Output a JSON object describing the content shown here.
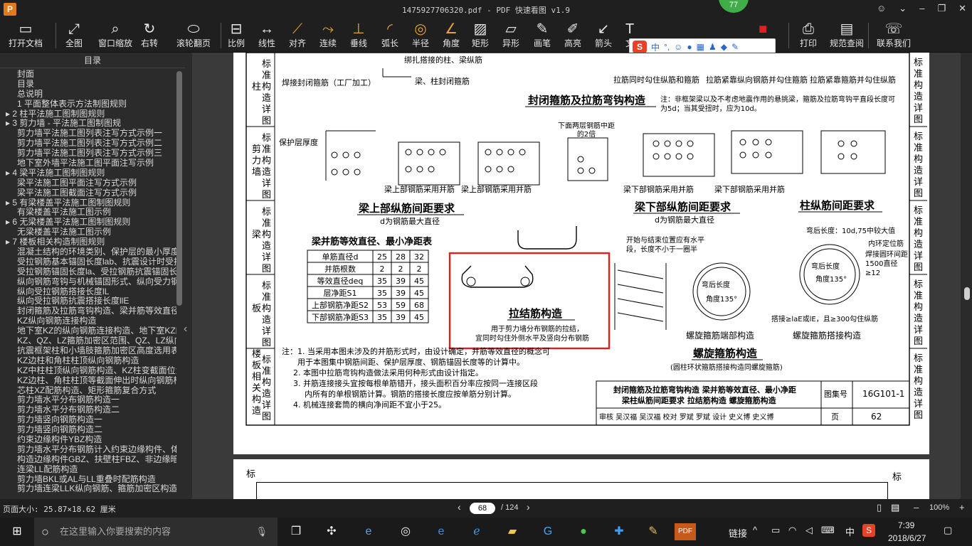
{
  "window": {
    "title": "1475927706320.pdf - PDF 快速看图 v1.9",
    "app_icon": "P",
    "badge": "77"
  },
  "toolbar": {
    "items": [
      {
        "label": "打开文档",
        "icon": "folder-icon"
      },
      {
        "label": "全图",
        "icon": "fullscreen-icon"
      },
      {
        "label": "窗口缩放",
        "icon": "zoom-icon"
      },
      {
        "label": "右转",
        "icon": "rotate-icon"
      },
      {
        "label": "滚轮翻页",
        "icon": "mouse-icon"
      },
      {
        "label": "比例",
        "icon": "scale-icon"
      },
      {
        "label": "线性",
        "icon": "linear-icon"
      },
      {
        "label": "对齐",
        "icon": "align-icon"
      },
      {
        "label": "连续",
        "icon": "continuous-icon"
      },
      {
        "label": "垂线",
        "icon": "perpendicular-icon"
      },
      {
        "label": "弧长",
        "icon": "arc-icon"
      },
      {
        "label": "半径",
        "icon": "radius-icon"
      },
      {
        "label": "角度",
        "icon": "angle-icon"
      },
      {
        "label": "矩形",
        "icon": "rect-icon"
      },
      {
        "label": "异形",
        "icon": "polygon-icon"
      },
      {
        "label": "画笔",
        "icon": "pen-icon"
      },
      {
        "label": "高亮",
        "icon": "highlight-icon"
      },
      {
        "label": "箭头",
        "icon": "arrow-icon"
      },
      {
        "label": "文",
        "icon": "text-icon"
      },
      {
        "label": "色",
        "icon": "color-icon"
      },
      {
        "label": "打印",
        "icon": "print-icon"
      },
      {
        "label": "规范查阅",
        "icon": "book-icon"
      },
      {
        "label": "联系我们",
        "icon": "contact-icon"
      }
    ]
  },
  "ime": {
    "logo": "S",
    "lang": "中",
    "punct": "°,"
  },
  "sidebar": {
    "header": "目录",
    "items": [
      {
        "t": "封面",
        "lvl": "l1"
      },
      {
        "t": "目录",
        "lvl": "l1"
      },
      {
        "t": "总说明",
        "lvl": "l1"
      },
      {
        "t": "1 平面整体表示方法制图规则",
        "lvl": "l1"
      },
      {
        "t": "▸ 2 柱平法施工图制图规则",
        "lvl": "l1e"
      },
      {
        "t": "▸ 3 剪力墙 - 平法施工图制图规",
        "lvl": "l1e"
      },
      {
        "t": "剪力墙平法施工图列表注写方式示例一",
        "lvl": "l2"
      },
      {
        "t": "剪力墙平法施工图列表注写方式示例二",
        "lvl": "l2"
      },
      {
        "t": "剪力墙平法施工图列表注写方式示例三",
        "lvl": "l2"
      },
      {
        "t": "地下室外墙平法施工图平面注写示例",
        "lvl": "l2"
      },
      {
        "t": "▸ 4 梁平法施工图制图规则",
        "lvl": "l1e"
      },
      {
        "t": "梁平法施工图平面注写方式示例",
        "lvl": "l2"
      },
      {
        "t": "梁平法施工图截面注写方式示例",
        "lvl": "l2"
      },
      {
        "t": "▸ 5 有梁楼盖平法施工图制图规则",
        "lvl": "l1e"
      },
      {
        "t": "有梁楼盖平法施工图示例",
        "lvl": "l2"
      },
      {
        "t": "▸ 6 无梁楼盖平法施工图制图规则",
        "lvl": "l1e"
      },
      {
        "t": "无梁楼盖平法施工图示例",
        "lvl": "l2"
      },
      {
        "t": "▸ 7 楼板相关构造制图规则",
        "lvl": "l1e"
      },
      {
        "t": "混凝土结构的环境类别、保护层的最小厚度",
        "lvl": "l2"
      },
      {
        "t": "受拉钢筋基本锚固长度lab、抗震设计时受拉",
        "lvl": "l2"
      },
      {
        "t": "受拉钢筋锚固长度la、受拉钢筋抗震锚固长",
        "lvl": "l2"
      },
      {
        "t": "纵向钢筋弯钩与机械锚固形式、纵向受力钢",
        "lvl": "l2"
      },
      {
        "t": "纵向受拉钢筋搭接长度lL",
        "lvl": "l2"
      },
      {
        "t": "纵向受拉钢筋抗震搭接长度llE",
        "lvl": "l2"
      },
      {
        "t": "封闭箍筋及拉筋弯钩构造、梁并筋等效直径",
        "lvl": "l2"
      },
      {
        "t": "KZ纵向钢筋连接构造",
        "lvl": "l2"
      },
      {
        "t": "地下室KZ的纵向钢筋连接构造、地下室KZ的",
        "lvl": "l2"
      },
      {
        "t": "KZ、QZ、LZ箍筋加密区范围、QZ、LZ纵向钢",
        "lvl": "l2"
      },
      {
        "t": "抗震框架柱和小墙肢箍筋加密区高度选用表",
        "lvl": "l2"
      },
      {
        "t": "KZ边柱和角柱柱顶纵向钢筋构造",
        "lvl": "l2"
      },
      {
        "t": "KZ中柱柱顶纵向钢筋构造、KZ柱变截面位置",
        "lvl": "l2"
      },
      {
        "t": "KZ边柱、角柱柱顶等截面伸出时纵向钢筋构",
        "lvl": "l2"
      },
      {
        "t": "芯柱XZ配筋构造、矩形箍筋复合方式",
        "lvl": "l2"
      },
      {
        "t": "剪力墙水平分布钢筋构造一",
        "lvl": "l2"
      },
      {
        "t": "剪力墙水平分布钢筋构造二",
        "lvl": "l2"
      },
      {
        "t": "剪力墙竖向钢筋构造一",
        "lvl": "l2"
      },
      {
        "t": "剪力墙竖向钢筋构造二",
        "lvl": "l2"
      },
      {
        "t": "约束边缘构件YBZ构造",
        "lvl": "l2"
      },
      {
        "t": "剪力墙水平分布钢筋计入约束边缘构件、体",
        "lvl": "l2"
      },
      {
        "t": "构造边缘构件GBZ、扶壁柱FBZ、非边缘暗柱",
        "lvl": "l2"
      },
      {
        "t": "连梁LL配筋构造",
        "lvl": "l2"
      },
      {
        "t": "剪力墙BKL或AL与LL重叠时配筋构造",
        "lvl": "l2"
      },
      {
        "t": "剪力墙连梁LLK纵向钢筋、箍筋加密区构造",
        "lvl": "l2"
      }
    ]
  },
  "page": {
    "left_tabs": [
      {
        "cat": "柱",
        "label": "标准构造详图"
      },
      {
        "cat": "剪力墙",
        "label": "标准构造详图"
      },
      {
        "cat": "梁",
        "label": "标准构造详图"
      },
      {
        "cat": "板",
        "label": "标准构造详图"
      },
      {
        "cat": "楼板相关构造",
        "label": "标准构造详图"
      }
    ],
    "right_tabs": [
      "标准构造详图",
      "标准构造详图",
      "标准构造详图",
      "标准构造详图",
      "标准构造详图"
    ],
    "top_labels": [
      "焊接封闭箍筋（工厂加工）",
      "绑扎搭接的柱、梁纵筋",
      "梁、柱封闭箍筋",
      "拉筋同时勾住纵筋和箍筋",
      "拉筋紧靠纵向钢筋并勾住箍筋",
      "拉筋紧靠箍筋并勾住纵筋"
    ],
    "t1": "封闭箍筋及拉筋弯钩构造",
    "note1": "注：非框架梁以及不考虑地震作用的悬挑梁，箍筋及拉筋弯钩平直段长度可为5d；当其受扭时，应为10d。",
    "t2": "梁上部纵筋间距要求",
    "t2s": "d为钢筋最大直径",
    "t3": "梁下部纵筋间距要求",
    "t3s": "d为钢筋最大直径",
    "t4": "柱纵筋间距要求",
    "sublabels": [
      "梁上部钢筋采用并筋",
      "梁上部钢筋采用并筋",
      "梁下部钢筋采用并筋",
      "梁下部钢筋采用并筋"
    ],
    "cover_label": "保护层厚度",
    "lower2": "下面两层钢筋中距的2倍",
    "table": {
      "title": "梁并筋等效直径、最小净距表",
      "rows": [
        [
          "单筋直径d",
          "25",
          "28",
          "32"
        ],
        [
          "并筋根数",
          "2",
          "2",
          "2"
        ],
        [
          "等效直径deq",
          "35",
          "39",
          "45"
        ],
        [
          "层净距S1",
          "35",
          "39",
          "45"
        ],
        [
          "上部钢筋净距S2",
          "53",
          "59",
          "68"
        ],
        [
          "下部钢筋净距S3",
          "35",
          "39",
          "45"
        ]
      ]
    },
    "tie": {
      "title": "拉结筋构造",
      "desc1": "用于剪力墙分布钢筋的拉结，",
      "desc2": "宜同时勾住外侧水平及竖向分布钢筋"
    },
    "spiral": {
      "title": "螺旋箍筋构造",
      "sub": "(圆柱环状箍筋搭接构造同螺旋箍筋)",
      "end_label": "螺旋箍筋端部构造",
      "lap_label": "螺旋箍筋搭接构造",
      "start_note": "开始与结束位置应有水平段，长度不小于一圈半",
      "bend": "弯后长度：10d,75中较大值",
      "bend2": "弯后长度",
      "angle": "角度135°",
      "inner": "内环定位筋",
      "weld": "焊接圆环间距1500直径≥12",
      "lap": "搭接≥laE或lE，且≥300勾住纵筋"
    },
    "notes": [
      "注：1. 当采用本图未涉及的并筋形式时，由设计确定，并筋等效直径的概念可",
      "用于本图集中钢筋间距、保护层厚度、钢筋锚固长度等的计算中。",
      "2. 本图中拉筋弯钩构造做法采用何种形式由设计指定。",
      "3. 并筋连接接头宜按每根单筋错开，接头面积百分率应按同一连接区段",
      "内所有的单根钢筋计算。钢筋的搭接长度应按单筋分别计算。",
      "4. 机械连接套筒的横向净间距不宜小于25。"
    ],
    "title_block": {
      "l1": "封闭箍筋及拉筋弯钩构造  梁并筋等效直径、最小净距",
      "l2": "梁柱纵筋间距要求  拉结筋构造  螺旋箍筋构造",
      "atlas_label": "图集号",
      "atlas": "16G101-1",
      "page_label": "页",
      "page": "62",
      "sign": "审核 吴汉福 吴汉福 校对 罗斌 罗斌 设计 史义博 史义博"
    },
    "page2_left": "标",
    "page2_right": "标"
  },
  "status": {
    "size": "页面大小: 25.87×18.62 厘米",
    "page": "68",
    "total": "/ 124",
    "zoom": "100%"
  },
  "taskbar": {
    "search": "在这里输入你要搜索的内容",
    "network": "链接",
    "time": "7:39",
    "date": "2018/6/27",
    "ime": "中"
  }
}
